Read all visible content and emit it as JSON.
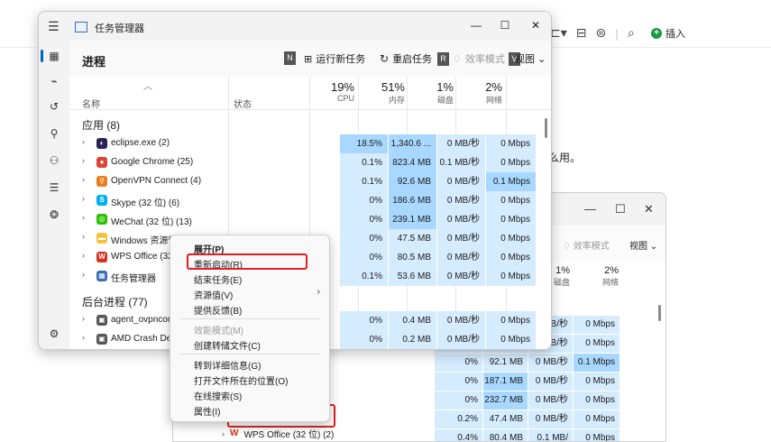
{
  "background": {
    "toolbar_icons": [
      "⊏▾",
      "⊟",
      "⊜",
      "|",
      "⌕"
    ],
    "insert_label": "插入",
    "insert_icon": "plus-circle-icon",
    "paragraph_fragment": "么用。"
  },
  "window2": {
    "controls": [
      "—",
      "☐",
      "✕"
    ],
    "efficiency_label": "效率模式",
    "view_label": "视图 ⌄",
    "disk_header": {
      "pct": "1%",
      "label": "磁盘"
    },
    "network_header": {
      "pct": "2%",
      "label": "网络"
    },
    "rows": [
      {
        "cpu": "",
        "mem": "",
        "disk": "MB/秒",
        "net": "0 Mbps"
      },
      {
        "cpu": "",
        "mem": "",
        "disk": "MB/秒",
        "net": "0 Mbps"
      },
      {
        "cpu": "0%",
        "mem": "92.1 MB",
        "disk": "0 MB/秒",
        "net": "0.1 Mbps"
      },
      {
        "cpu": "0%",
        "mem": "187.1 MB",
        "disk": "0 MB/秒",
        "net": "0 Mbps"
      },
      {
        "cpu": "0%",
        "mem": "232.7 MB",
        "disk": "0 MB/秒",
        "net": "0 Mbps"
      },
      {
        "cpu": "0.2%",
        "mem": "47.4 MB",
        "disk": "0 MB/秒",
        "net": "0 Mbps"
      },
      {
        "cpu": "0.4%",
        "mem": "80.4 MB",
        "disk": "0.1 MB/秒",
        "net": "0 Mbps"
      }
    ],
    "wps_row_name": "WPS Office (32 位) (2)"
  },
  "window": {
    "title": "任务管理器",
    "controls": {
      "minimize": "—",
      "maximize": "☐",
      "close": "✕"
    },
    "page_title": "进程",
    "cmd": {
      "n_key": "N",
      "new_task": "运行新任务",
      "restart_task": "重启任务",
      "r_key": "R",
      "efficiency": "效率模式",
      "v_key": "V",
      "view": "视图 ⌄"
    },
    "headers": {
      "name": "名称",
      "state": "状态",
      "cpu": {
        "pct": "19%",
        "label": "CPU"
      },
      "memory": {
        "pct": "51%",
        "label": "内存"
      },
      "disk": {
        "pct": "1%",
        "label": "磁盘"
      },
      "network": {
        "pct": "2%",
        "label": "网络"
      }
    },
    "apps_group": "应用 (8)",
    "bg_group": "后台进程 (77)",
    "apps": [
      {
        "name": "eclipse.exe (2)",
        "icon": "eclipse-icon",
        "cpu": "18.5%",
        "mem": "1,340.6 ...",
        "disk": "0 MB/秒",
        "net": "0 Mbps"
      },
      {
        "name": "Google Chrome (25)",
        "icon": "chrome-icon",
        "cpu": "0.1%",
        "mem": "823.4 MB",
        "disk": "0.1 MB/秒",
        "net": "0 Mbps"
      },
      {
        "name": "OpenVPN Connect (4)",
        "icon": "openvpn-icon",
        "cpu": "0.1%",
        "mem": "92.6 MB",
        "disk": "0 MB/秒",
        "net": "0.1 Mbps"
      },
      {
        "name": "Skype (32 位) (6)",
        "icon": "skype-icon",
        "cpu": "0%",
        "mem": "186.6 MB",
        "disk": "0 MB/秒",
        "net": "0 Mbps"
      },
      {
        "name": "WeChat (32 位) (13)",
        "icon": "wechat-icon",
        "cpu": "0%",
        "mem": "239.1 MB",
        "disk": "0 MB/秒",
        "net": "0 Mbps"
      },
      {
        "name": "Windows 资源管",
        "icon": "explorer-icon",
        "cpu": "0%",
        "mem": "47.5 MB",
        "disk": "0 MB/秒",
        "net": "0 Mbps"
      },
      {
        "name": "WPS Office (32",
        "icon": "wps-icon",
        "cpu": "0%",
        "mem": "80.5 MB",
        "disk": "0 MB/秒",
        "net": "0 Mbps"
      },
      {
        "name": "任务管理器",
        "icon": "taskmgr-icon",
        "cpu": "0.1%",
        "mem": "53.6 MB",
        "disk": "0 MB/秒",
        "net": "0 Mbps"
      }
    ],
    "bg_procs": [
      {
        "name": "agent_ovpncon",
        "icon": "app-icon",
        "cpu": "0%",
        "mem": "0.4 MB",
        "disk": "0 MB/秒",
        "net": "0 Mbps"
      },
      {
        "name": "AMD Crash De",
        "icon": "app-icon",
        "cpu": "0%",
        "mem": "0.2 MB",
        "disk": "0 MB/秒",
        "net": "0 Mbps"
      }
    ]
  },
  "context_menu": {
    "items": [
      {
        "label": "展开(P)",
        "bold": true
      },
      {
        "label": "重新启动(R)",
        "highlighted": true
      },
      {
        "label": "结束任务(E)"
      },
      {
        "label": "资源值(V)",
        "submenu": true
      },
      {
        "label": "提供反馈(B)"
      },
      {
        "label": "效能模式(M)",
        "disabled": true
      },
      {
        "label": "创建转储文件(C)"
      },
      {
        "label": "转到详细信息(G)"
      },
      {
        "label": "打开文件所在的位置(O)"
      },
      {
        "label": "在线搜索(S)"
      },
      {
        "label": "属性(I)"
      }
    ]
  }
}
